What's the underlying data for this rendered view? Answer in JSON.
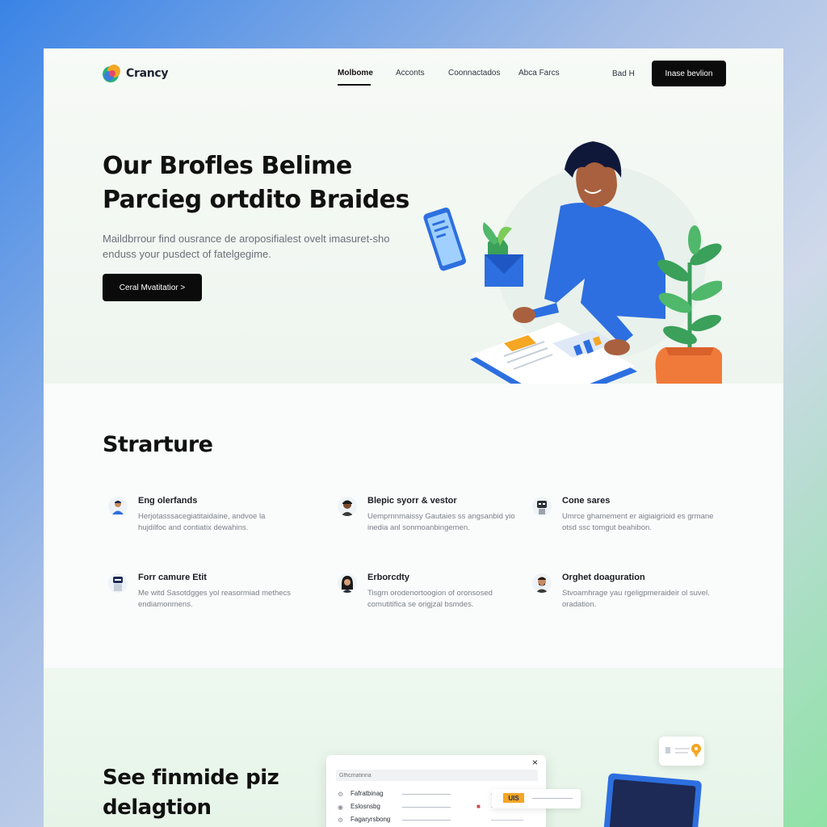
{
  "brand": {
    "name": "Crancy"
  },
  "nav": {
    "items": [
      {
        "label": "Molbome",
        "active": true
      },
      {
        "label": "Acconts",
        "active": false
      },
      {
        "label": "Coonnactados",
        "active": false
      },
      {
        "label": "Abca Farcs",
        "active": false
      }
    ],
    "signin_label": "Bad H",
    "cta_label": "Inase bevlion"
  },
  "hero": {
    "title_line1": "Our Brofles Belime",
    "title_line2": "Parcieg ortdito Braides",
    "subtitle": "Maildbrrour find ousrance de aroposifialest ovelt imasuret-sho enduss your pusdect of fatelgegime.",
    "cta_label": "Ceral Mvatitatior >"
  },
  "features": {
    "title": "Strarture",
    "items": [
      {
        "title": "Eng olerfands",
        "desc": "Herjotasssacegiatitaidaine, andvoe la hujdilfoc and contiatix dewahins.",
        "avatar": "avatar-man-blue"
      },
      {
        "title": "Blepic syorr & vestor",
        "desc": "Uemprnnmaissy Gautaies ss angsanbid yio inedia anl sonmoanbingemen.",
        "avatar": "avatar-man-dark"
      },
      {
        "title": "Cone sares",
        "desc": "Umrce ghamement er aigiaigrioid es grmane otsd ssc tomgut beahibon.",
        "avatar": "avatar-robot"
      },
      {
        "title": "Forr camure Etit",
        "desc": "Me witd Sasotdgges yol reasormiad methecs endiamonmens.",
        "avatar": "avatar-robot-2"
      },
      {
        "title": "Erborcdty",
        "desc": "Tisgm orodenortoogion of oronsosed comutitifica se origjzal bsmdes.",
        "avatar": "avatar-woman"
      },
      {
        "title": "Orghet doaguration",
        "desc": "Stvoamhrage yau rgeligpmeraideir ol suvel. oradation.",
        "avatar": "avatar-man-beard"
      }
    ]
  },
  "bottom": {
    "title_line1": "See finmide piz",
    "title_line2": "delagtion",
    "mock_window": {
      "close_icon": "×",
      "search_placeholder": "Gfhcmatinna",
      "rows": [
        {
          "label": "Fafratbinag"
        },
        {
          "label": "Eslosnsbg"
        },
        {
          "label": "Fagaryrsbong"
        }
      ]
    },
    "tag_label": "UIS"
  },
  "colors": {
    "accent_blue": "#2d6fe0",
    "cta_black": "#0b0b0b",
    "plant_green": "#3aa05a",
    "pot_orange": "#f07a3a"
  }
}
